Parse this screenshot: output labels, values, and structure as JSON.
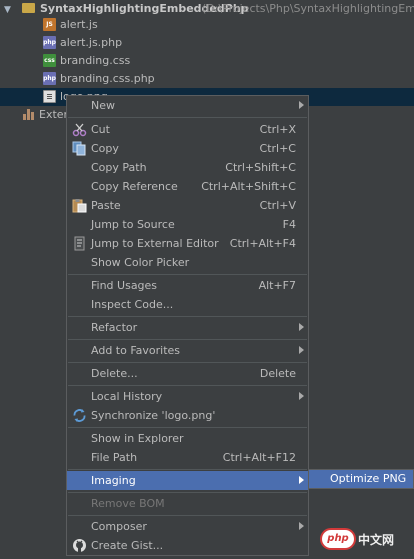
{
  "tree": {
    "project_name": "SyntaxHighlightingEmbeddedPhp",
    "project_path": "(D:\\Projects\\Php\\SyntaxHighlightingEm",
    "files": [
      {
        "name": "alert.js",
        "type": "js",
        "icon_text": "JS"
      },
      {
        "name": "alert.js.php",
        "type": "php",
        "icon_text": "php"
      },
      {
        "name": "branding.css",
        "type": "css",
        "icon_text": "css"
      },
      {
        "name": "branding.css.php",
        "type": "php",
        "icon_text": "php"
      },
      {
        "name": "logo.png",
        "type": "png",
        "icon_text": ""
      }
    ],
    "external": "Extern"
  },
  "menu": {
    "new": "New",
    "cut": {
      "label": "Cut",
      "shortcut": "Ctrl+X"
    },
    "copy": {
      "label": "Copy",
      "shortcut": "Ctrl+C"
    },
    "copy_path": {
      "label": "Copy Path",
      "shortcut": "Ctrl+Shift+C"
    },
    "copy_reference": {
      "label": "Copy Reference",
      "shortcut": "Ctrl+Alt+Shift+C"
    },
    "paste": {
      "label": "Paste",
      "shortcut": "Ctrl+V"
    },
    "jump_to_source": {
      "label": "Jump to Source",
      "shortcut": "F4"
    },
    "jump_to_external_editor": {
      "label": "Jump to External Editor",
      "shortcut": "Ctrl+Alt+F4"
    },
    "show_color_picker": "Show Color Picker",
    "find_usages": {
      "label": "Find Usages",
      "shortcut": "Alt+F7"
    },
    "inspect_code": "Inspect Code...",
    "refactor": "Refactor",
    "add_to_favorites": "Add to Favorites",
    "delete": {
      "label": "Delete...",
      "shortcut": "Delete"
    },
    "local_history": "Local History",
    "synchronize": "Synchronize 'logo.png'",
    "show_in_explorer": "Show in Explorer",
    "file_path": {
      "label": "File Path",
      "shortcut": "Ctrl+Alt+F12"
    },
    "imaging": "Imaging",
    "remove_bom": "Remove BOM",
    "composer": "Composer",
    "create_gist": "Create Gist..."
  },
  "submenu": {
    "optimize_png": "Optimize PNG"
  },
  "watermark": {
    "badge": "php",
    "text": "中文网"
  },
  "colors": {
    "background": "#3c3f41",
    "highlight": "#4b6eaf",
    "tree_selection": "#0d293e"
  }
}
